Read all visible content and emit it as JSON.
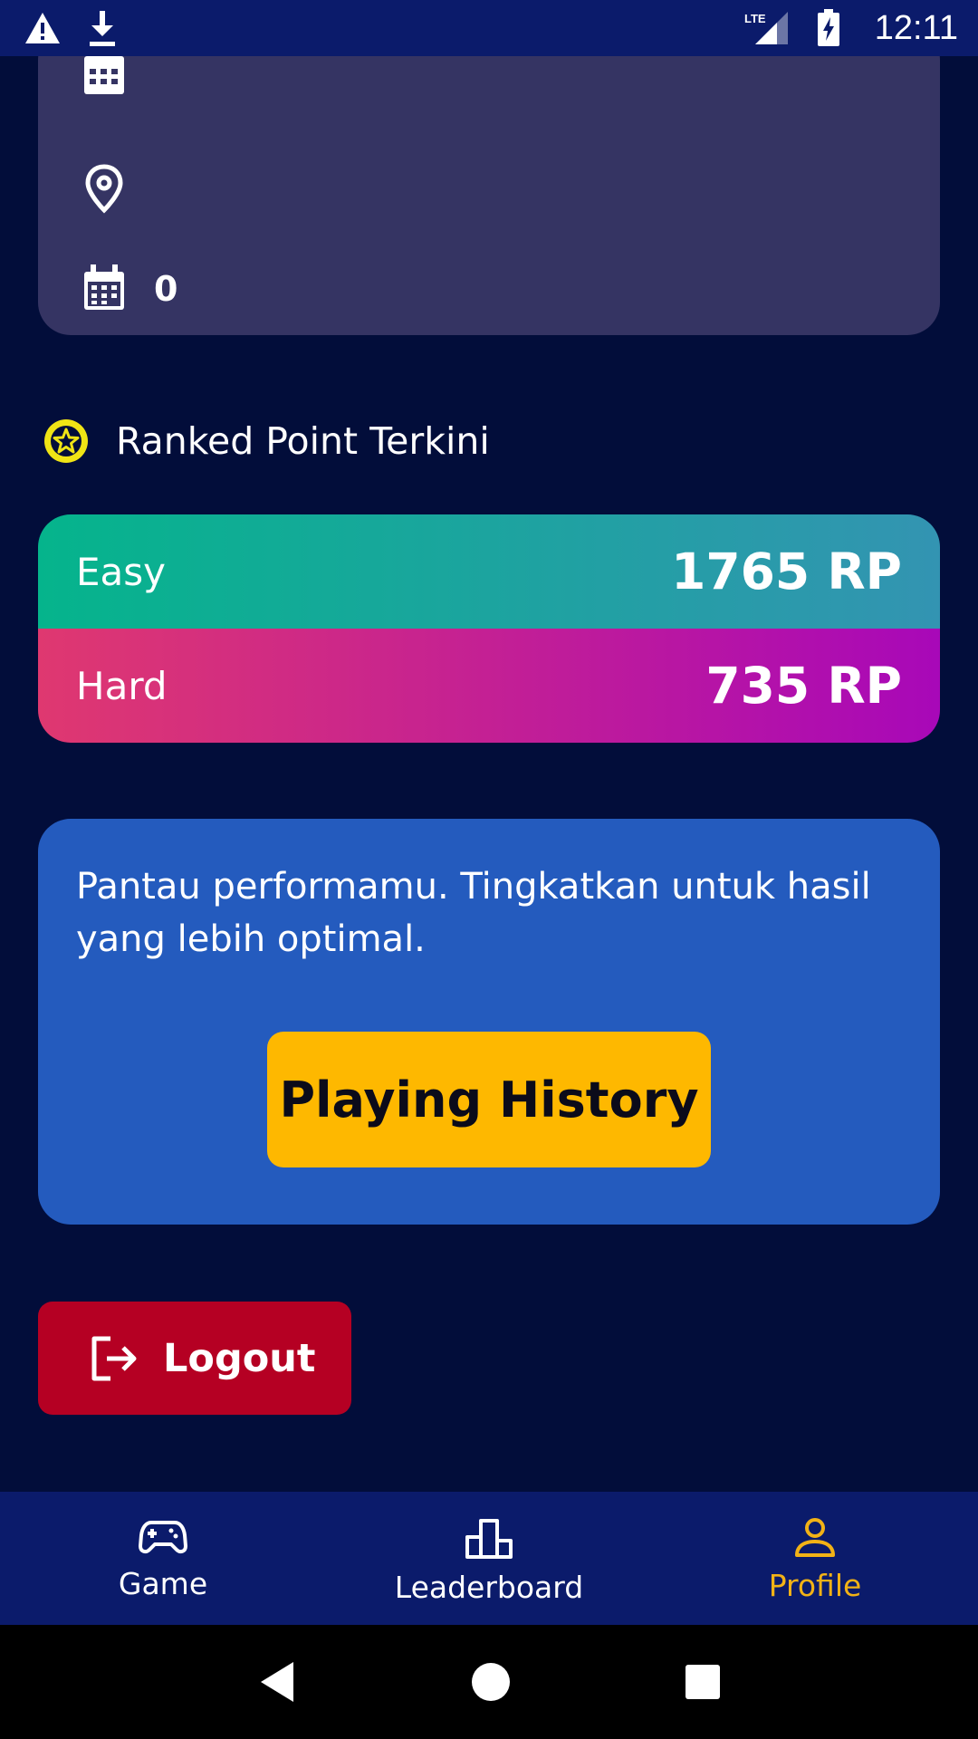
{
  "status_bar": {
    "time": "12:11",
    "network": "LTE",
    "icons": [
      "warning-icon",
      "download-icon",
      "signal-icon",
      "battery-charging-icon"
    ]
  },
  "profile_info": {
    "rows": [
      {
        "icon": "calendar-icon",
        "value": ""
      },
      {
        "icon": "location-pin-icon",
        "value": ""
      },
      {
        "icon": "calendar-icon",
        "value": "0"
      }
    ]
  },
  "ranked_section": {
    "title": "Ranked Point Terkini",
    "icon": "star-badge-icon",
    "rows": [
      {
        "label": "Easy",
        "value": "1765 RP"
      },
      {
        "label": "Hard",
        "value": "735 RP"
      }
    ]
  },
  "promo": {
    "text": "Pantau performamu. Tingkatkan untuk hasil yang lebih optimal.",
    "button_label": "Playing History"
  },
  "logout": {
    "label": "Logout",
    "icon": "logout-icon"
  },
  "bottom_nav": {
    "items": [
      {
        "label": "Game",
        "icon": "gamepad-icon",
        "active": false
      },
      {
        "label": "Leaderboard",
        "icon": "leaderboard-icon",
        "active": false
      },
      {
        "label": "Profile",
        "icon": "person-icon",
        "active": true
      }
    ]
  },
  "colors": {
    "background": "#020d3a",
    "bars": "#0b1b6b",
    "card": "#353463",
    "promo": "#245bbe",
    "accent": "#feb800",
    "logout": "#b50023",
    "active_nav": "#f2b216"
  }
}
